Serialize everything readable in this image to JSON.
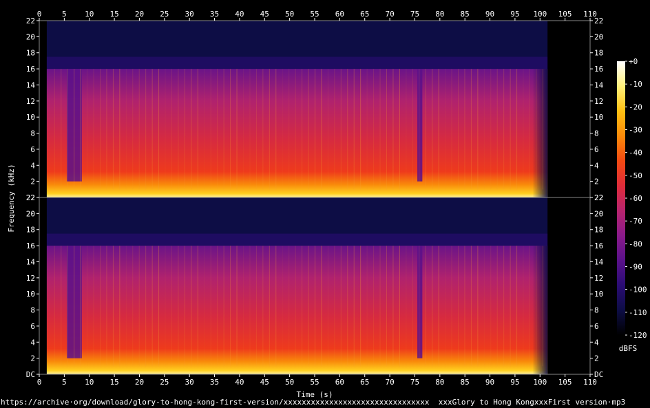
{
  "chart_data": {
    "type": "heatmap",
    "xlabel": "Time (s)",
    "ylabel": "Frequency (kHz)",
    "xlim": [
      0,
      110
    ],
    "x_ticks": [
      "0",
      "5",
      "10",
      "15",
      "20",
      "25",
      "30",
      "35",
      "40",
      "45",
      "50",
      "55",
      "60",
      "65",
      "70",
      "75",
      "80",
      "85",
      "90",
      "95",
      "100",
      "105",
      "110"
    ],
    "ylim_khz": [
      0,
      22
    ],
    "y_ticks": [
      "DC",
      "2",
      "4",
      "6",
      "8",
      "10",
      "12",
      "14",
      "16",
      "18",
      "20",
      "22"
    ],
    "channels": 2,
    "colorbar": {
      "label": "dBFS",
      "ticks": [
        "+0",
        "-10",
        "-20",
        "-30",
        "-40",
        "-50",
        "-60",
        "-70",
        "-80",
        "-90",
        "-100",
        "-110",
        "-120"
      ],
      "range": [
        -120,
        0
      ],
      "colors": [
        "#000000",
        "#0d0d45",
        "#2a0c74",
        "#5a118a",
        "#8a1a8a",
        "#b8246e",
        "#df2c3a",
        "#f44a12",
        "#fb8a09",
        "#ffc012",
        "#fff07a",
        "#ffffff"
      ]
    },
    "features": {
      "lowpass_cutoff_khz": 16,
      "audio_start_s": 1.5,
      "audio_end_s": 101.5,
      "quiet_intervals_s": [
        [
          5.5,
          8.5
        ],
        [
          75.5,
          76.5
        ]
      ]
    }
  },
  "caption": "https://archive·org/download/glory-to-hong-kong-first-version/xxxxxxxxxxxxxxxxxxxxxxxxxxxxxxxx  xxxGlory to Hong KongxxxFirst version·mp3"
}
